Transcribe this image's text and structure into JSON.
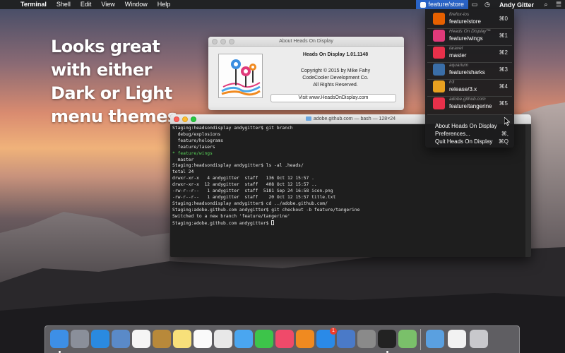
{
  "menubar": {
    "app": "Terminal",
    "menus": [
      "Shell",
      "Edit",
      "View",
      "Window",
      "Help"
    ],
    "hod_branch": "feature/store",
    "user": "Andy Gitter"
  },
  "promo": {
    "lines": [
      "Looks great",
      "with either",
      "Dark or Light",
      "menu themes"
    ]
  },
  "about": {
    "title": "About Heads On Display",
    "app_name": "Heads On Display 1.01.1148",
    "copyright": "Copyright © 2015 by Mike Fahy",
    "company": "CodeCooler Development Co.",
    "rights": "All Rights Reserved.",
    "visit_label": "Visit www.HeadsOnDisplay.com"
  },
  "terminal": {
    "title": "adobe.github.com — bash — 128×24",
    "lines": [
      {
        "text": "Staging:headsondisplay andygitter$ git branch",
        "color": ""
      },
      {
        "text": "  debug/explosions",
        "color": ""
      },
      {
        "text": "  feature/holograms",
        "color": ""
      },
      {
        "text": "  feature/lasers",
        "color": ""
      },
      {
        "text": "* feature/wings",
        "color": "green"
      },
      {
        "text": "  master",
        "color": ""
      },
      {
        "text": "Staging:headsondisplay andygitter$ ls -al .heads/",
        "color": ""
      },
      {
        "text": "total 24",
        "color": ""
      },
      {
        "text": "drwxr-xr-x   4 andygitter  staff   136 Oct 12 15:57 .",
        "color": ""
      },
      {
        "text": "drwxr-xr-x  12 andygitter  staff   408 Oct 12 15:57 ..",
        "color": ""
      },
      {
        "text": "-rw-r--r--   1 andygitter  staff  5181 Sep 24 16:58 icon.png",
        "color": ""
      },
      {
        "text": "-rw-r--r--   1 andygitter  staff    20 Oct 12 15:57 title.txt",
        "color": ""
      },
      {
        "text": "Staging:headsondisplay andygitter$ cd ../adobe.github.com/",
        "color": ""
      },
      {
        "text": "Staging:adobe.github.com andygitter$ git checkout -b feature/tangerine",
        "color": ""
      },
      {
        "text": "Switched to a new branch 'feature/tangerine'",
        "color": ""
      },
      {
        "text": "Staging:adobe.github.com andygitter$ ",
        "color": ""
      }
    ]
  },
  "dropdown": {
    "items": [
      {
        "repo": "firefox-ios",
        "branch": "feature/store",
        "shortcut": "⌘0",
        "color": "#e66000"
      },
      {
        "repo": "Heads On Display™",
        "branch": "feature/wings",
        "shortcut": "⌘1",
        "color": "#e03a7a"
      },
      {
        "repo": "laravel",
        "branch": "master",
        "shortcut": "⌘2",
        "color": "#e8304a"
      },
      {
        "repo": "aquarium",
        "branch": "feature/sharks",
        "shortcut": "⌘3",
        "color": "#3a6ea8"
      },
      {
        "repo": "h3",
        "branch": "release/3.x",
        "shortcut": "⌘4",
        "color": "#e8a020"
      },
      {
        "repo": "adobe.github.com",
        "branch": "feature/tangerine",
        "shortcut": "⌘5",
        "color": "#e8304a"
      }
    ],
    "about_label": "About Heads On Display",
    "prefs_label": "Preferences...",
    "prefs_shortcut": "⌘,",
    "quit_label": "Quit Heads On Display",
    "quit_shortcut": "⌘Q"
  },
  "dock": {
    "apps": [
      {
        "name": "finder-icon",
        "color": "#3d8fe6"
      },
      {
        "name": "launchpad-icon",
        "color": "#8a8f9a"
      },
      {
        "name": "safari-icon",
        "color": "#2a8ae0"
      },
      {
        "name": "preview-icon",
        "color": "#5a8ac8"
      },
      {
        "name": "calendar-icon",
        "color": "#f5f5f5"
      },
      {
        "name": "contacts-icon",
        "color": "#b8893a"
      },
      {
        "name": "notes-icon",
        "color": "#f7e07a"
      },
      {
        "name": "reminders-icon",
        "color": "#fafafa"
      },
      {
        "name": "photos-icon",
        "color": "#e8e8e8"
      },
      {
        "name": "messages-icon",
        "color": "#4aa6f0"
      },
      {
        "name": "facetime-icon",
        "color": "#3dc44a"
      },
      {
        "name": "itunes-icon",
        "color": "#f04a6a"
      },
      {
        "name": "ibooks-icon",
        "color": "#f08a20"
      },
      {
        "name": "app-store-icon",
        "color": "#2a8ae8"
      },
      {
        "name": "xcode-icon",
        "color": "#4a7ac8"
      },
      {
        "name": "system-preferences-icon",
        "color": "#8a8a8a"
      },
      {
        "name": "terminal-icon",
        "color": "#222222"
      },
      {
        "name": "maps-icon",
        "color": "#7ac06a"
      }
    ],
    "app_store_badge": "1"
  },
  "colors": {
    "menubar_highlight": "#2a64c8",
    "terminal_green": "#58d058"
  }
}
